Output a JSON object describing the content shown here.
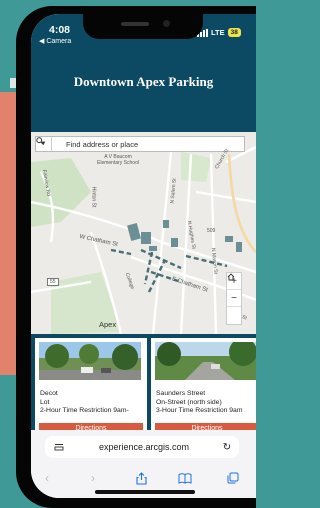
{
  "status": {
    "time": "4:08",
    "back_label": "◀ Camera",
    "network": "LTE",
    "battery": "38"
  },
  "app": {
    "title": "Downtown Apex Parking"
  },
  "map": {
    "search_placeholder": "Find address or place",
    "labels": {
      "school": "A V Baucom\nElementary School",
      "fairview": "Fairview Rd",
      "hinton": "Hinton St",
      "w_chatham": "W Chatham St",
      "e_chatham": "E Chatham St",
      "n_hughes": "N Hughes St",
      "n_mason": "N Mason St",
      "salem": "N Salem St",
      "apex": "Apex",
      "route55": "55",
      "route509": "509",
      "center_st": "Center St",
      "college": "College",
      "church": "Church St"
    },
    "zoom_in": "+",
    "zoom_out": "−",
    "home_icon": "home-icon"
  },
  "cards": [
    {
      "line1": "Decot",
      "line2": "Lot",
      "line3": "2-Hour Time Restriction 9am-",
      "button": "Directions"
    },
    {
      "line1": "Saunders Street",
      "line2": "On-Street (north side)",
      "line3": "3-Hour Time Restriction 9am",
      "button": "Directions"
    }
  ],
  "browser": {
    "url": "experience.arcgis.com"
  },
  "colors": {
    "header": "#0b4a62",
    "accent": "#d85a3f",
    "ios_blue": "#1a73e8"
  }
}
